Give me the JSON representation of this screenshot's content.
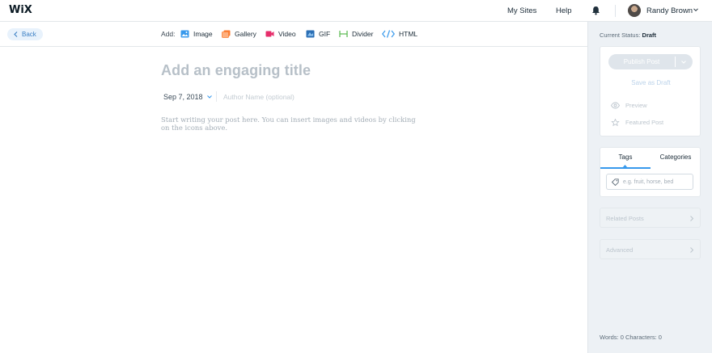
{
  "app": {
    "logo": "WiX"
  },
  "topbar": {
    "my_sites": "My Sites",
    "help": "Help",
    "user_name": "Randy Brown",
    "notifications_icon": "bell-icon"
  },
  "toolbar": {
    "back_label": "Back",
    "add_label": "Add:",
    "items": [
      {
        "label": "Image",
        "icon": "image-icon",
        "color": "#3899ec"
      },
      {
        "label": "Gallery",
        "icon": "gallery-icon",
        "color": "#fb7d33"
      },
      {
        "label": "Video",
        "icon": "video-icon",
        "color": "#e62e6b"
      },
      {
        "label": "GIF",
        "icon": "gif-icon",
        "color": "#3899ec"
      },
      {
        "label": "Divider",
        "icon": "divider-icon",
        "color": "#60bc57"
      },
      {
        "label": "HTML",
        "icon": "html-icon",
        "color": "#3899ec"
      }
    ]
  },
  "editor": {
    "title_placeholder": "Add an engaging title",
    "date": "Sep 7, 2018",
    "author_placeholder": "Author Name (optional)",
    "body_placeholder": "Start writing your post here. You can insert images and videos by clicking on the icons above."
  },
  "sidebar": {
    "status_label": "Current Status:",
    "status_value": "Draft",
    "publish_label": "Publish Post",
    "save_draft_label": "Save as Draft",
    "preview_label": "Preview",
    "featured_label": "Featured Post",
    "tabs": [
      {
        "label": "Tags",
        "active": true
      },
      {
        "label": "Categories",
        "active": false
      }
    ],
    "tag_placeholder": "e.g. fruit, horse, bed",
    "related_posts_label": "Related Posts",
    "advanced_label": "Advanced",
    "word_count_text": "Words: 0 Characters: 0"
  },
  "colors": {
    "accent": "#3899ec",
    "sidebar_bg": "#edf1f5",
    "back_button_bg": "#e8f2fc"
  }
}
